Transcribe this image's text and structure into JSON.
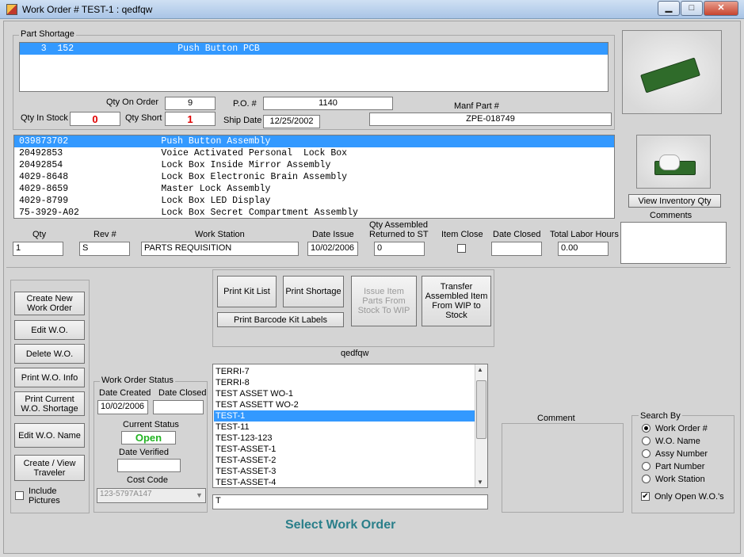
{
  "window": {
    "title": "Work Order # TEST-1 : qedfqw",
    "min": "▁",
    "max": "□",
    "close": "✕"
  },
  "part_shortage": {
    "legend": "Part Shortage",
    "items": [
      "   3  152                   Push Button PCB"
    ],
    "qty_on_order_label": "Qty On Order",
    "qty_on_order": "9",
    "po_label": "P.O. #",
    "po": "1140",
    "manf_part_label": "Manf Part #",
    "manf_part": "ZPE-018749",
    "qty_in_stock_label": "Qty In Stock",
    "qty_in_stock": "0",
    "qty_short_label": "Qty Short",
    "qty_short": "1",
    "ship_date_label": "Ship Date",
    "ship_date": "12/25/2002"
  },
  "assemblies": [
    "039873702                 Push Button Assembly",
    "20492853                  Voice Activated Personal  Lock Box",
    "20492854                  Lock Box Inside Mirror Assembly",
    "4029-8648                 Lock Box Electronic Brain Assembly",
    "4029-8659                 Master Lock Assembly",
    "4029-8799                 Lock Box LED Display",
    "75-3929-A02               Lock Box Secret Compartment Assembly"
  ],
  "view_inventory_label": "View Inventory Qty",
  "comments_label": "Comments",
  "detail": {
    "qty_label": "Qty",
    "qty": "1",
    "rev_label": "Rev #",
    "rev": "S",
    "station_label": "Work Station",
    "station": "PARTS REQUISITION",
    "date_issue_label": "Date Issue",
    "date_issue": "10/02/2006",
    "returned_label1": "Qty Assembled",
    "returned_label2": "Returned to ST",
    "returned": "0",
    "item_close_label": "Item Close",
    "date_closed_label": "Date Closed",
    "date_closed": "",
    "labor_label": "Total Labor Hours",
    "labor": "0.00"
  },
  "left_buttons": [
    "Create New Work Order",
    "Edit W.O.",
    "Delete W.O.",
    "Print W.O. Info",
    "Print Current W.O. Shortage",
    "Edit W.O. Name",
    "Create / View Traveler"
  ],
  "include_pictures_label": "Include Pictures",
  "action_buttons": {
    "print_kit": "Print Kit List",
    "print_shortage": "Print Shortage",
    "issue_item": "Issue Item Parts From Stock To WIP",
    "transfer": "Transfer Assembled Item From WIP to Stock",
    "print_barcode": "Print Barcode Kit Labels"
  },
  "status": {
    "legend": "Work Order Status",
    "date_created_label": "Date Created",
    "date_created": "10/02/2006",
    "date_closed_label": "Date Closed",
    "date_closed": "",
    "current_status_label": "Current Status",
    "current_status": "Open",
    "date_verified_label": "Date Verified",
    "date_verified": "",
    "cost_code_label": "Cost Code",
    "cost_code": "123-5797A147"
  },
  "wo_list": {
    "title": "qedfqw",
    "items": [
      "TERRI-7",
      "TERRI-8",
      "TEST ASSET WO-1",
      "TEST ASSETT WO-2",
      "TEST-1",
      "TEST-11",
      "TEST-123-123",
      "TEST-ASSET-1",
      "TEST-ASSET-2",
      "TEST-ASSET-3",
      "TEST-ASSET-4"
    ],
    "selected": "TEST-1",
    "filter": "T"
  },
  "comment_label": "Comment",
  "search": {
    "legend": "Search By",
    "options": [
      "Work Order #",
      "W.O. Name",
      "Assy Number",
      "Part Number",
      "Work Station"
    ],
    "selected": "Work Order #",
    "only_open_label": "Only Open W.O.'s"
  },
  "footer": "Select Work Order",
  "colors": {
    "selection": "#3399ff",
    "open_status": "#22b422",
    "footer": "#2a7f8a",
    "short_red": "#e00000"
  }
}
